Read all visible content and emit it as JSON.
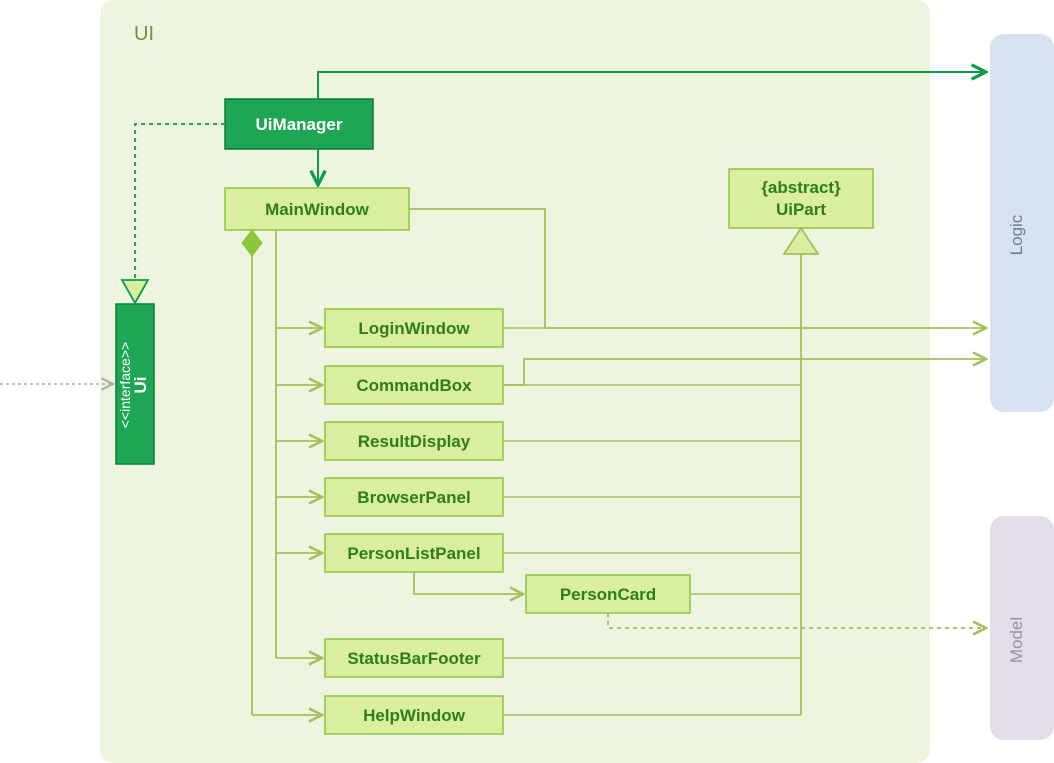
{
  "package": {
    "name": "UI"
  },
  "interface": {
    "stereotype": "<<interface>>",
    "name": "Ui"
  },
  "classes": {
    "uiManager": "UiManager",
    "mainWindow": "MainWindow",
    "loginWindow": "LoginWindow",
    "commandBox": "CommandBox",
    "resultDisplay": "ResultDisplay",
    "browserPanel": "BrowserPanel",
    "personListPanel": "PersonListPanel",
    "personCard": "PersonCard",
    "statusBarFooter": "StatusBarFooter",
    "helpWindow": "HelpWindow",
    "uiPart": {
      "modifier": "{abstract}",
      "name": "UiPart"
    }
  },
  "externalPackages": {
    "logic": "Logic",
    "model": "Model"
  },
  "colors": {
    "pkgBg": "#edf5de",
    "pkgBorder": "#c9dca1",
    "classFill": "#d9ee9f",
    "classStroke": "#8cc63f",
    "darkGreen": "#1ea654",
    "strokeGreen": "#0b9c4a",
    "lineOlive": "#a4c05a",
    "logicBg": "#d6e2f0",
    "logicBorder": "#b8c8dd",
    "modelBg": "#e3dde9",
    "modelBorder": "#cfc6d8",
    "gray": "#b0b0b0"
  }
}
